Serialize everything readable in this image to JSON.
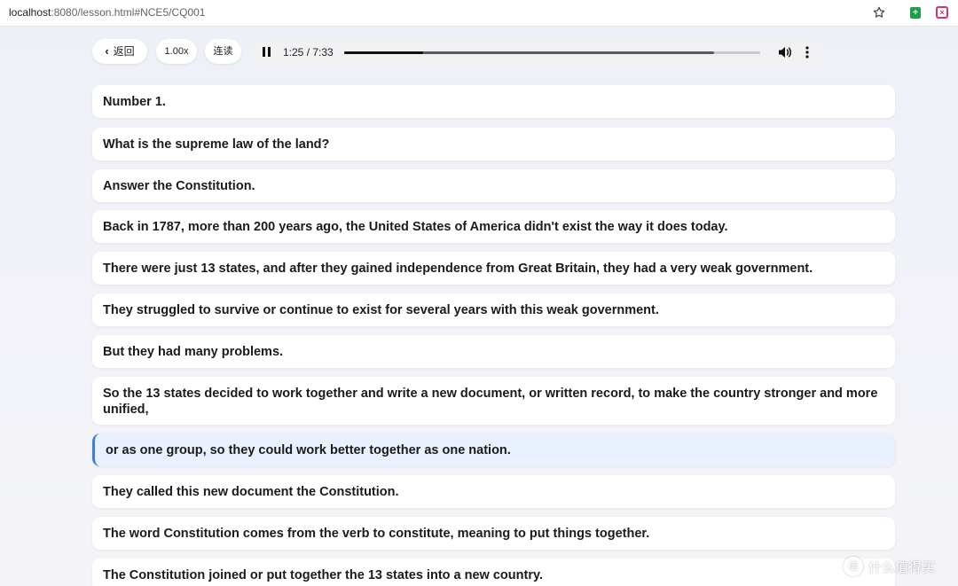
{
  "browser": {
    "url_host": "localhost",
    "url_path": ":8080/lesson.html#NCE5/CQ001"
  },
  "player": {
    "back_label": "返回",
    "speed_label": "1.00x",
    "continuous_label": "连读",
    "time": "1:25 / 7:33",
    "played_fraction": 0.19,
    "buffered_fraction": 0.89
  },
  "sentences": [
    "Number 1.",
    "What is the supreme law of the land?",
    "Answer the Constitution.",
    "Back in 1787, more than 200 years ago, the United States of America didn't exist the way it does today.",
    "There were just 13 states, and after they gained independence from Great Britain, they had a very weak government.",
    "They struggled to survive or continue to exist for several years with this weak government.",
    "But they had many problems.",
    "So the 13 states decided to work together and write a new document, or written record, to make the country stronger and more unified,",
    "or as one group, so they could work better together as one nation.",
    "They called this new document the Constitution.",
    "The word Constitution comes from the verb to constitute, meaning to put things together.",
    "The Constitution joined or put together the 13 states into a new country."
  ],
  "active_sentence": 8,
  "watermark": {
    "badge": "值",
    "text": "什么值得买"
  },
  "colors": {
    "active_bg": "#e8f1fd",
    "active_border": "#3d7fd6"
  }
}
